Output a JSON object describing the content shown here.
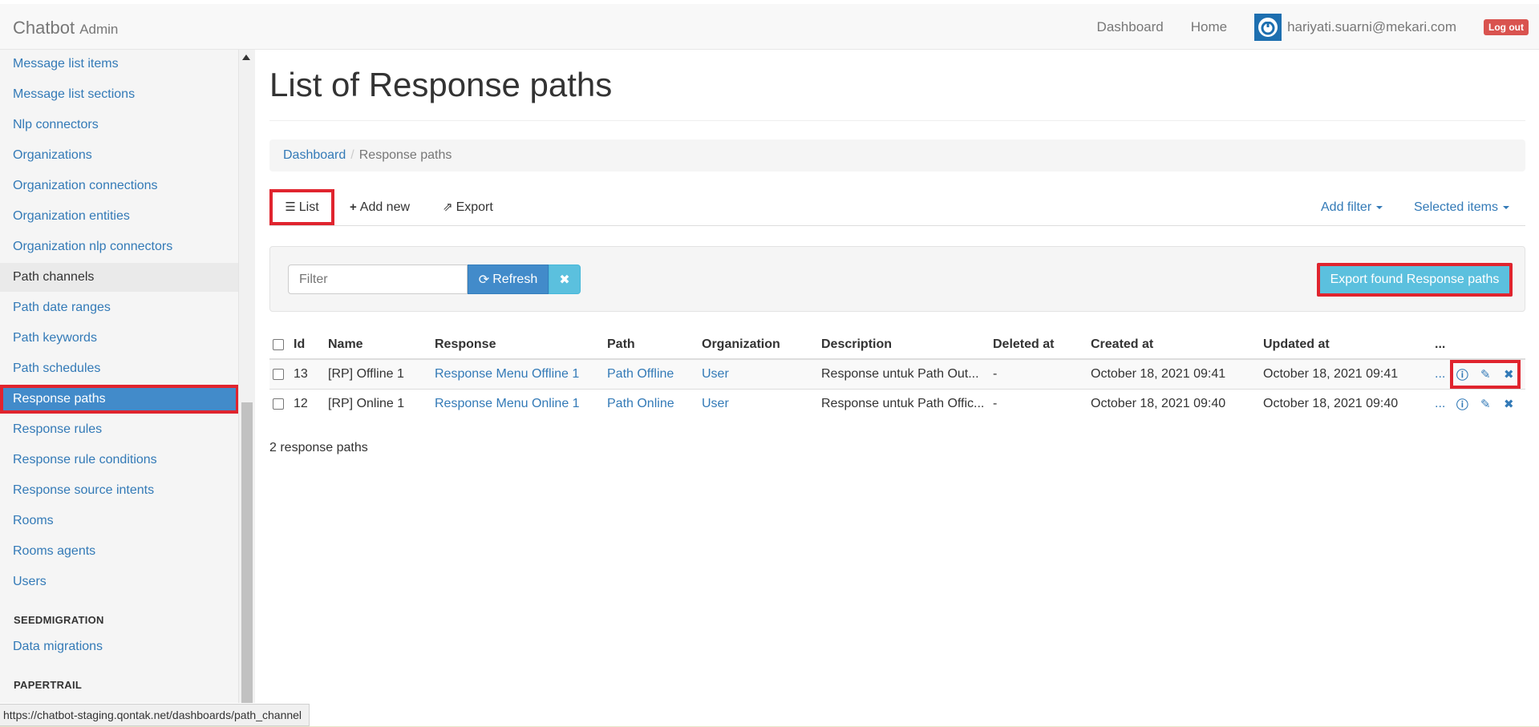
{
  "brand": {
    "name": "Chatbot",
    "suffix": "Admin"
  },
  "topnav": {
    "dashboard": "Dashboard",
    "home": "Home",
    "user_email": "hariyati.suarni@mekari.com",
    "logout": "Log out"
  },
  "sidebar": {
    "items": [
      "Message list items",
      "Message list sections",
      "Nlp connectors",
      "Organizations",
      "Organization connections",
      "Organization entities",
      "Organization nlp connectors",
      "Path channels",
      "Path date ranges",
      "Path keywords",
      "Path schedules",
      "Response paths",
      "Response rules",
      "Response rule conditions",
      "Response source intents",
      "Rooms",
      "Rooms agents",
      "Users"
    ],
    "section_seed": "SEEDMIGRATION",
    "seed_items": [
      "Data migrations"
    ],
    "section_paper": "PAPERTRAIL",
    "active": "Response paths",
    "hovered": "Path channels"
  },
  "status_url": "https://chatbot-staging.qontak.net/dashboards/path_channel",
  "page": {
    "title": "List of Response paths"
  },
  "breadcrumb": {
    "root": "Dashboard",
    "current": "Response paths"
  },
  "tabs": {
    "list": "List",
    "add_new": "Add new",
    "export": "Export",
    "add_filter": "Add filter",
    "selected_items": "Selected items"
  },
  "filter": {
    "placeholder": "Filter",
    "refresh": "Refresh",
    "export_found": "Export found Response paths"
  },
  "table": {
    "headers": [
      "Id",
      "Name",
      "Response",
      "Path",
      "Organization",
      "Description",
      "Deleted at",
      "Created at",
      "Updated at",
      "..."
    ],
    "rows": [
      {
        "id": "13",
        "name": "[RP] Offline 1",
        "response": "Response Menu Offline 1",
        "path": "Path Offline",
        "organization": "User",
        "description": "Response untuk Path Out...",
        "deleted_at": "-",
        "created_at": "October 18, 2021 09:41",
        "updated_at": "October 18, 2021 09:41",
        "more": "..."
      },
      {
        "id": "12",
        "name": "[RP] Online 1",
        "response": "Response Menu Online 1",
        "path": "Path Online",
        "organization": "User",
        "description": "Response untuk Path Offic...",
        "deleted_at": "-",
        "created_at": "October 18, 2021 09:40",
        "updated_at": "October 18, 2021 09:40",
        "more": "..."
      }
    ]
  },
  "count_text": "2 response paths",
  "colors": {
    "link": "#337ab7",
    "active": "#428bca",
    "highlight": "#e0242e",
    "info_button": "#5bc0de"
  }
}
